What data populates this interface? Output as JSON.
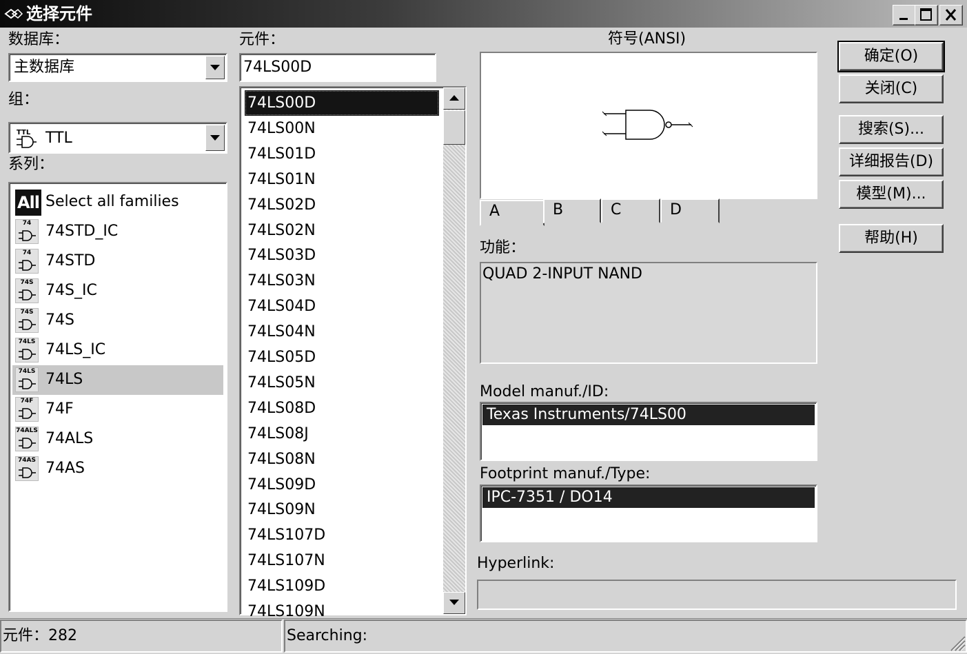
{
  "window": {
    "title": "选择元件"
  },
  "database": {
    "label": "数据库：",
    "value": "主数据库"
  },
  "group": {
    "label": "组：",
    "value": "TTL",
    "icon": "ttl-gate-icon"
  },
  "family": {
    "label": "系列：",
    "items": [
      {
        "icon_text": "All",
        "label": "Select all families"
      },
      {
        "icon_text": "74",
        "label": "74STD_IC"
      },
      {
        "icon_text": "74",
        "label": "74STD"
      },
      {
        "icon_text": "74S",
        "label": "74S_IC"
      },
      {
        "icon_text": "74S",
        "label": "74S"
      },
      {
        "icon_text": "74LS",
        "label": "74LS_IC"
      },
      {
        "icon_text": "74LS",
        "label": "74LS"
      },
      {
        "icon_text": "74F",
        "label": "74F"
      },
      {
        "icon_text": "74ALS",
        "label": "74ALS"
      },
      {
        "icon_text": "74AS",
        "label": "74AS"
      }
    ],
    "selected": "74LS"
  },
  "component": {
    "label": "元件：",
    "value": "74LS00D",
    "items": [
      "74LS00D",
      "74LS00N",
      "74LS01D",
      "74LS01N",
      "74LS02D",
      "74LS02N",
      "74LS03D",
      "74LS03N",
      "74LS04D",
      "74LS04N",
      "74LS05D",
      "74LS05N",
      "74LS08D",
      "74LS08J",
      "74LS08N",
      "74LS09D",
      "74LS09N",
      "74LS107D",
      "74LS107N",
      "74LS109D",
      "74LS109N"
    ],
    "selected": "74LS00D"
  },
  "symbol": {
    "label": "符号(ANSI)",
    "tabs": [
      "A",
      "B",
      "C",
      "D"
    ],
    "active_tab": "A",
    "icon": "nand-gate-icon"
  },
  "function": {
    "label": "功能：",
    "value": "QUAD 2-INPUT NAND"
  },
  "model": {
    "label": "Model manuf./ID:",
    "value": "Texas Instruments/74LS00"
  },
  "footprint": {
    "label": "Footprint manuf./Type:",
    "value": "IPC-7351 / DO14"
  },
  "hyperlink": {
    "label": "Hyperlink:",
    "value": ""
  },
  "buttons": {
    "ok": "确定(O)",
    "close": "关闭(C)",
    "search": "搜索(S)...",
    "detail": "详细报告(D)",
    "model": "模型(M)...",
    "help": "帮助(H)"
  },
  "status": {
    "count": "元件：282",
    "searching": "Searching:"
  }
}
